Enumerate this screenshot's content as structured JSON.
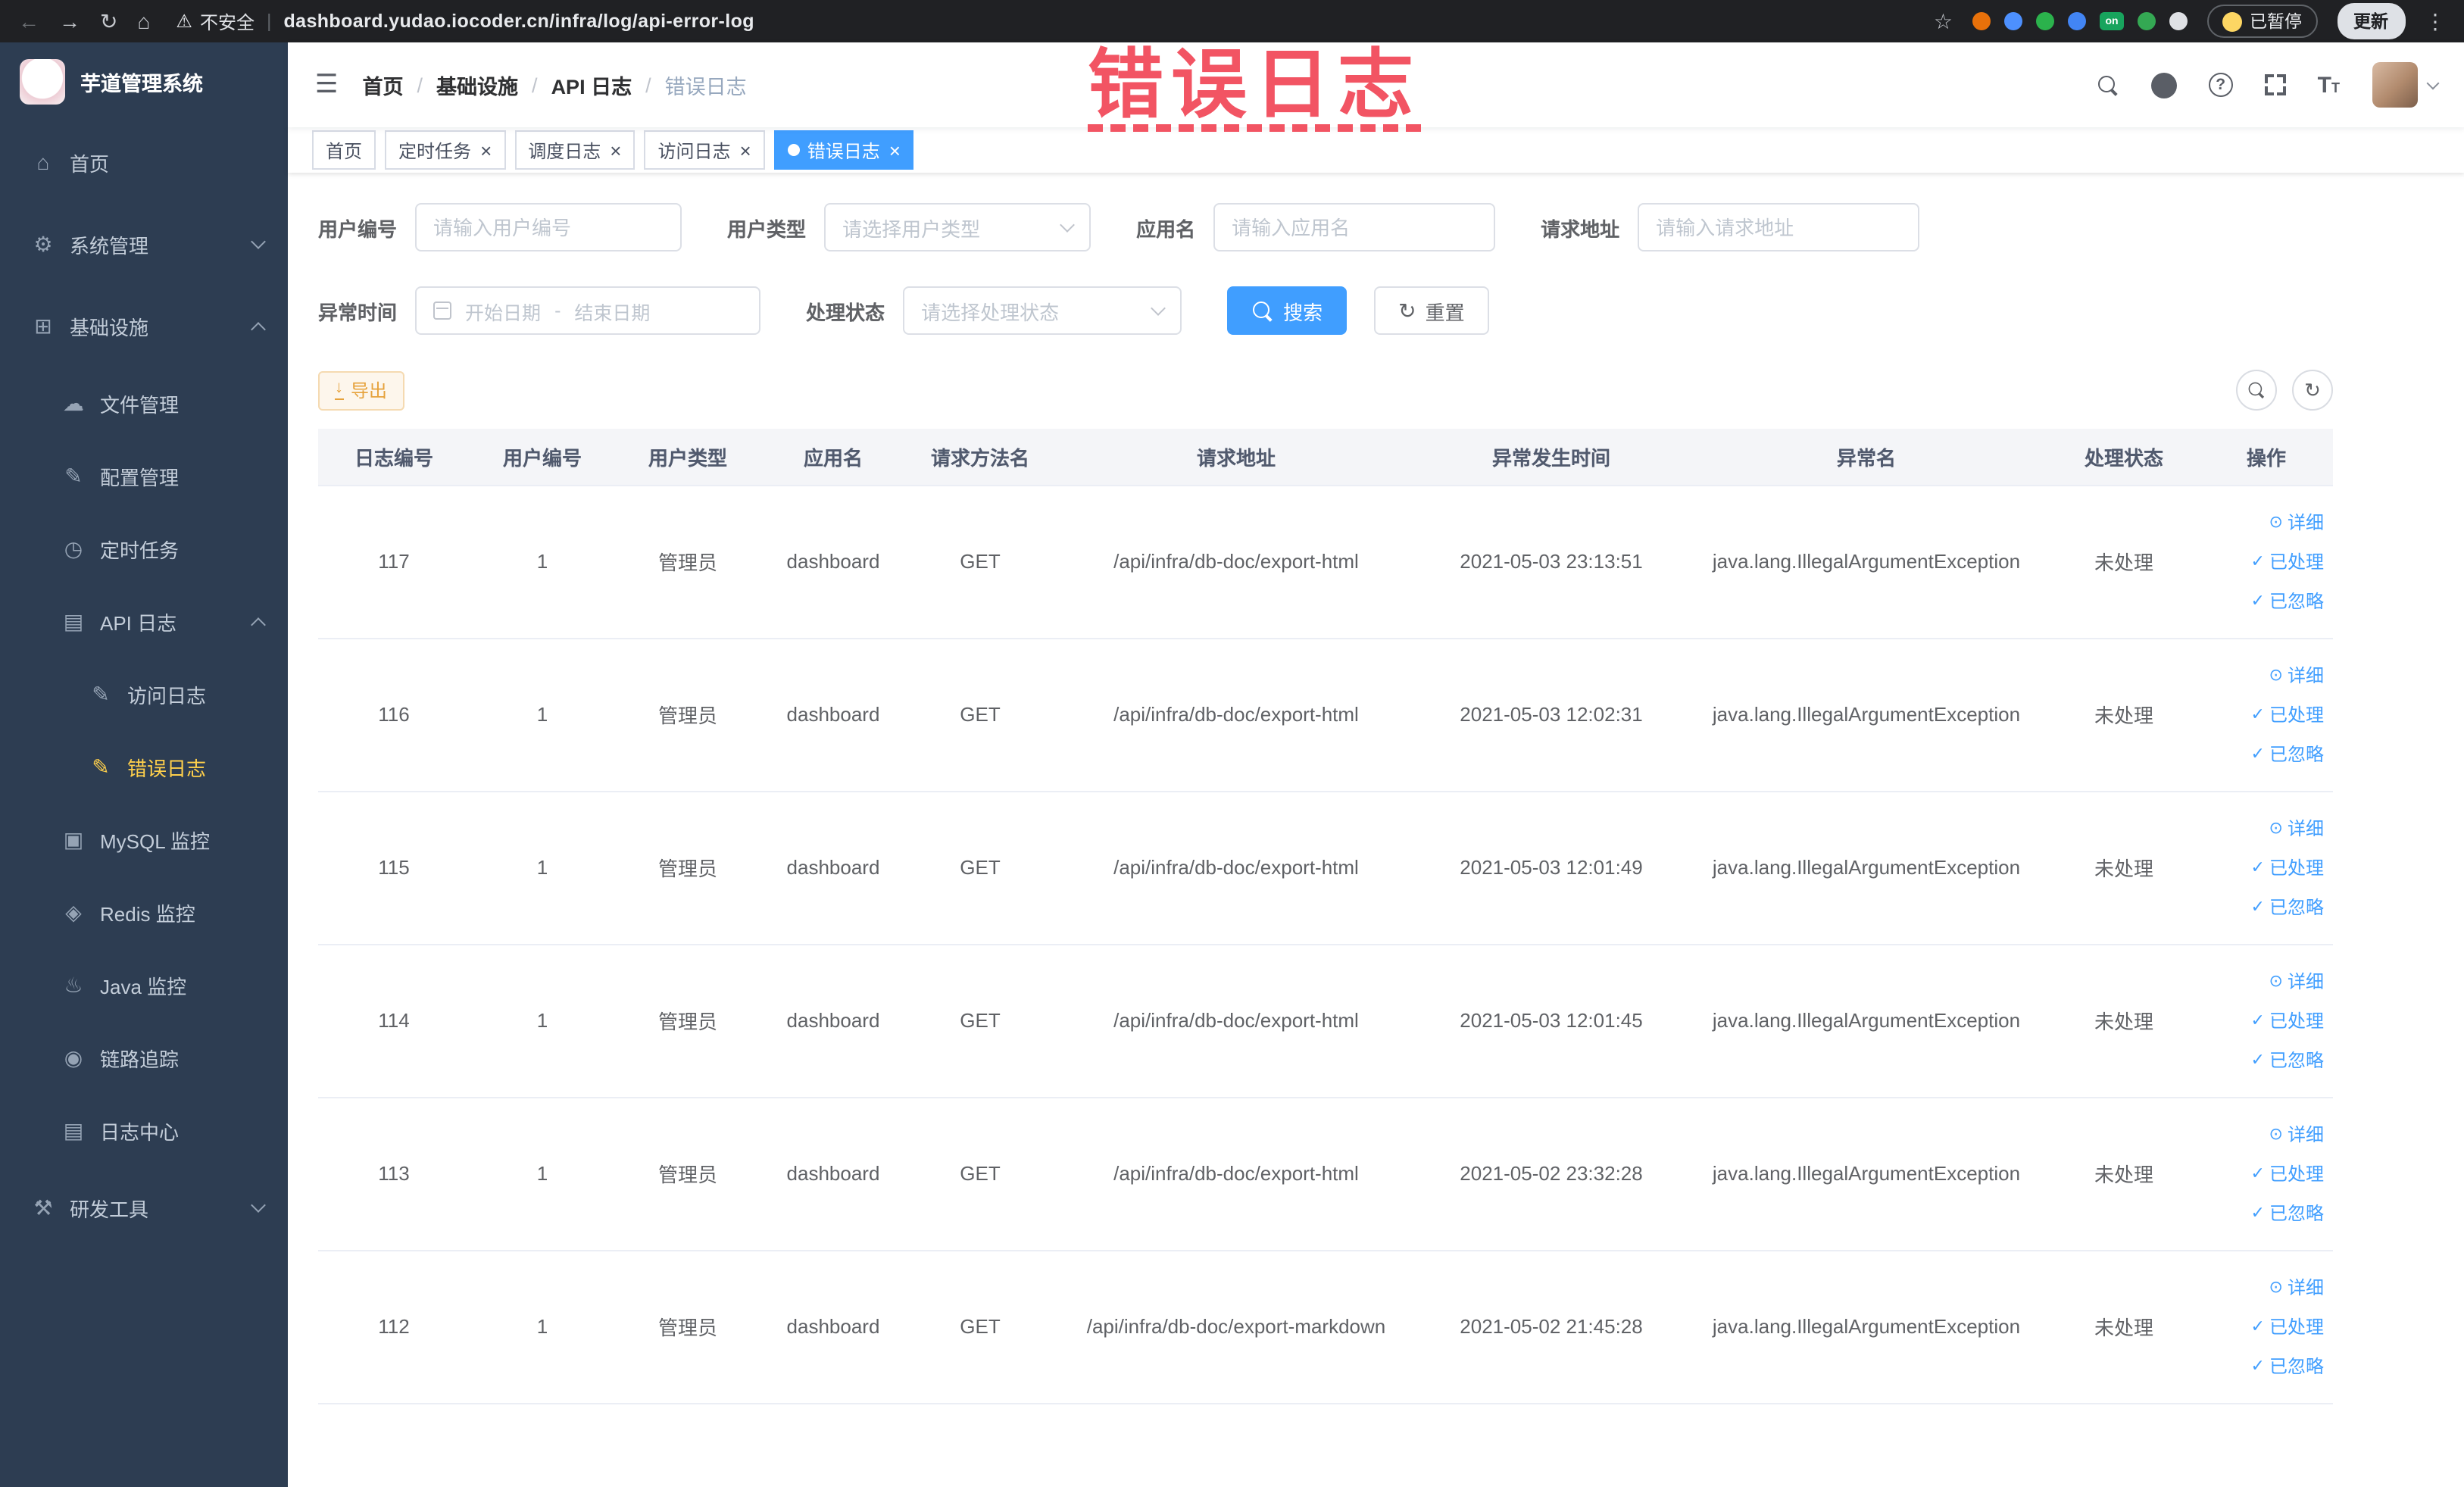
{
  "colors": {
    "primary": "#409eff",
    "sidebar_bg": "#2d3d52",
    "active_menu": "#ffd04b",
    "warning": "#e6a23c",
    "annotation": "#f25463",
    "tag_active": "#409eff"
  },
  "browser": {
    "security_label": "不安全",
    "url": "dashboard.yudao.iocoder.cn/infra/log/api-error-log",
    "paused_label": "已暂停",
    "update_label": "更新",
    "extensions": [
      {
        "name": "extension-orange",
        "color": "#e8710a",
        "label": ""
      },
      {
        "name": "extension-blue-drop",
        "color": "#4d90fe",
        "label": ""
      },
      {
        "name": "extension-green-circle",
        "color": "#2bb24c",
        "label": ""
      },
      {
        "name": "extension-blue-grid",
        "color": "#4285f4",
        "label": ""
      },
      {
        "name": "extension-on-badge",
        "color": "#18a45d",
        "label": "on"
      },
      {
        "name": "extension-green-leaf",
        "color": "#34a853",
        "label": ""
      },
      {
        "name": "extension-pin",
        "color": "#dfe1e5",
        "label": ""
      }
    ]
  },
  "annotation": {
    "text": "错误日志",
    "color": "#f25463"
  },
  "sidebar": {
    "title": "芋道管理系统",
    "items": [
      {
        "label": "首页",
        "icon": "home-icon",
        "level": 1,
        "arrow": "",
        "active": false
      },
      {
        "label": "系统管理",
        "icon": "gear-icon",
        "level": 1,
        "arrow": "down",
        "active": false
      },
      {
        "label": "基础设施",
        "icon": "infra-icon",
        "level": 1,
        "arrow": "up",
        "active": false
      },
      {
        "label": "文件管理",
        "icon": "file-icon",
        "level": 2,
        "arrow": "",
        "active": false
      },
      {
        "label": "配置管理",
        "icon": "config-icon",
        "level": 2,
        "arrow": "",
        "active": false
      },
      {
        "label": "定时任务",
        "icon": "task-icon",
        "level": 2,
        "arrow": "",
        "active": false
      },
      {
        "label": "API 日志",
        "icon": "apilog-icon",
        "level": 2,
        "arrow": "up",
        "active": false
      },
      {
        "label": "访问日志",
        "icon": "doc-icon",
        "level": 3,
        "arrow": "",
        "active": false
      },
      {
        "label": "错误日志",
        "icon": "doc-icon",
        "level": 3,
        "arrow": "",
        "active": true
      },
      {
        "label": "MySQL 监控",
        "icon": "mysql-icon",
        "level": 2,
        "arrow": "",
        "active": false
      },
      {
        "label": "Redis 监控",
        "icon": "redis-icon",
        "level": 2,
        "arrow": "",
        "active": false
      },
      {
        "label": "Java 监控",
        "icon": "java-icon",
        "level": 2,
        "arrow": "",
        "active": false
      },
      {
        "label": "链路追踪",
        "icon": "trace-icon",
        "level": 2,
        "arrow": "",
        "active": false
      },
      {
        "label": "日志中心",
        "icon": "logcenter-icon",
        "level": 2,
        "arrow": "",
        "active": false
      },
      {
        "label": "研发工具",
        "icon": "tools-icon",
        "level": 1,
        "arrow": "down",
        "active": false
      }
    ]
  },
  "header": {
    "breadcrumb": [
      "首页",
      "基础设施",
      "API 日志",
      "错误日志"
    ],
    "right_icons": [
      "search-icon",
      "github-icon",
      "help-icon",
      "fullscreen-icon",
      "font-size-icon",
      "avatar"
    ]
  },
  "tabs": [
    {
      "label": "首页",
      "closable": false,
      "active": false
    },
    {
      "label": "定时任务",
      "closable": true,
      "active": false
    },
    {
      "label": "调度日志",
      "closable": true,
      "active": false
    },
    {
      "label": "访问日志",
      "closable": true,
      "active": false
    },
    {
      "label": "错误日志",
      "closable": true,
      "active": true
    }
  ],
  "filters": {
    "user_id": {
      "label": "用户编号",
      "placeholder": "请输入用户编号",
      "value": ""
    },
    "user_type": {
      "label": "用户类型",
      "placeholder": "请选择用户类型"
    },
    "app_name": {
      "label": "应用名",
      "placeholder": "请输入应用名",
      "value": ""
    },
    "request_url": {
      "label": "请求地址",
      "placeholder": "请输入请求地址",
      "value": ""
    },
    "exception_time": {
      "label": "异常时间",
      "start_placeholder": "开始日期",
      "separator": "-",
      "end_placeholder": "结束日期"
    },
    "process_status": {
      "label": "处理状态",
      "placeholder": "请选择处理状态"
    },
    "search_label": "搜索",
    "reset_label": "重置"
  },
  "toolbar": {
    "export_label": "导出"
  },
  "table": {
    "columns": [
      "日志编号",
      "用户编号",
      "用户类型",
      "应用名",
      "请求方法名",
      "请求地址",
      "异常发生时间",
      "异常名",
      "处理状态",
      "操作"
    ],
    "row_actions": [
      "详细",
      "已处理",
      "已忽略"
    ],
    "rows": [
      {
        "id": "117",
        "user_id": "1",
        "user_type": "管理员",
        "app_name": "dashboard",
        "method": "GET",
        "url": "/api/infra/db-doc/export-html",
        "time": "2021-05-03 23:13:51",
        "exception": "java.lang.IllegalArgumentException",
        "status": "未处理"
      },
      {
        "id": "116",
        "user_id": "1",
        "user_type": "管理员",
        "app_name": "dashboard",
        "method": "GET",
        "url": "/api/infra/db-doc/export-html",
        "time": "2021-05-03 12:02:31",
        "exception": "java.lang.IllegalArgumentException",
        "status": "未处理"
      },
      {
        "id": "115",
        "user_id": "1",
        "user_type": "管理员",
        "app_name": "dashboard",
        "method": "GET",
        "url": "/api/infra/db-doc/export-html",
        "time": "2021-05-03 12:01:49",
        "exception": "java.lang.IllegalArgumentException",
        "status": "未处理"
      },
      {
        "id": "114",
        "user_id": "1",
        "user_type": "管理员",
        "app_name": "dashboard",
        "method": "GET",
        "url": "/api/infra/db-doc/export-html",
        "time": "2021-05-03 12:01:45",
        "exception": "java.lang.IllegalArgumentException",
        "status": "未处理"
      },
      {
        "id": "113",
        "user_id": "1",
        "user_type": "管理员",
        "app_name": "dashboard",
        "method": "GET",
        "url": "/api/infra/db-doc/export-html",
        "time": "2021-05-02 23:32:28",
        "exception": "java.lang.IllegalArgumentException",
        "status": "未处理"
      },
      {
        "id": "112",
        "user_id": "1",
        "user_type": "管理员",
        "app_name": "dashboard",
        "method": "GET",
        "url": "/api/infra/db-doc/export-markdown",
        "time": "2021-05-02 21:45:28",
        "exception": "java.lang.IllegalArgumentException",
        "status": "未处理"
      }
    ]
  }
}
